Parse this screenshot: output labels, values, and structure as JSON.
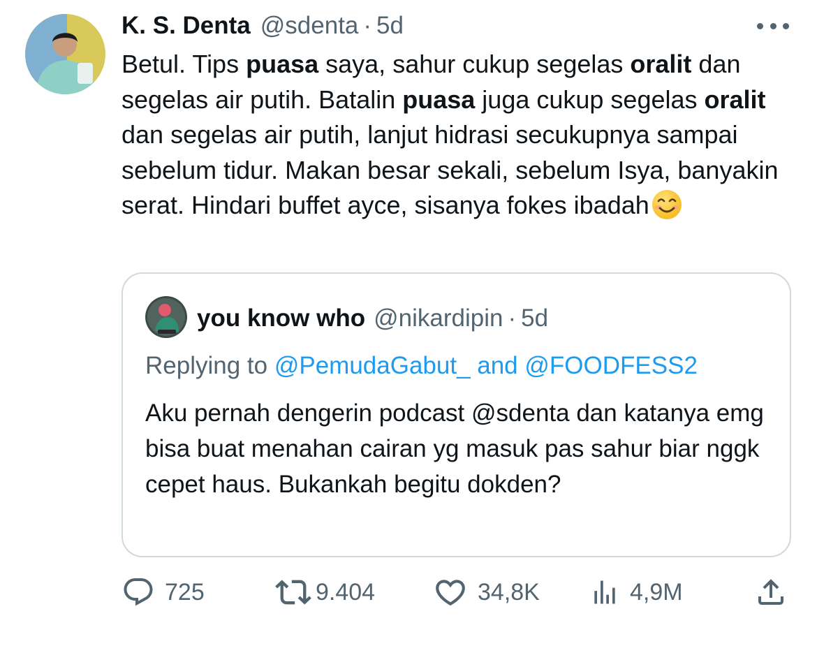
{
  "tweet": {
    "author_name": "K. S. Denta",
    "author_handle": "@sdenta",
    "separator": "·",
    "time": "5d",
    "text": {
      "s1": "Betul. Tips ",
      "b1": "puasa",
      "s2": " saya, sahur cukup segelas ",
      "b2": "oralit",
      "s3": " dan segelas air putih. Batalin ",
      "b3": "puasa",
      "s4": " juga cukup segelas ",
      "b4": "oralit",
      "s5": " dan segelas air putih, lanjut hidrasi secukupnya sampai sebelum tidur. Makan besar sekali, sebelum Isya, banyakin serat. Hindari buffet ayce, sisanya fokes ibadah",
      "emoji": "smiling-face-emoji"
    }
  },
  "quote": {
    "author_name": "you know who",
    "author_handle": "@nikardipin",
    "separator": "·",
    "time": "5d",
    "replying_prefix": "Replying to ",
    "mention1": "@PemudaGabut_",
    "and_word": " and ",
    "mention2": "@FOODFESS2",
    "text": "Aku pernah dengerin podcast @sdenta  dan katanya emg bisa buat menahan cairan yg masuk pas sahur biar nggk cepet haus. Bukankah begitu dokden?"
  },
  "actions": {
    "replies": "725",
    "retweets": "9.404",
    "likes": "34,8K",
    "views": "4,9M"
  },
  "colors": {
    "text": "#0f1419",
    "secondary": "#536471",
    "link": "#1d9bf0",
    "border": "#cfd9de"
  },
  "icons": [
    "reply-icon",
    "retweet-icon",
    "like-icon",
    "views-icon",
    "share-icon",
    "more-icon"
  ]
}
